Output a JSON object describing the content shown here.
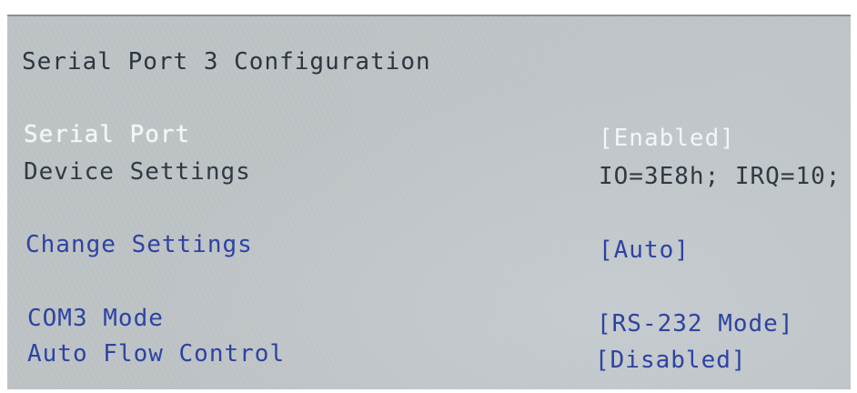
{
  "page": {
    "title": "Serial Port 3 Configuration"
  },
  "settings": [
    {
      "label": "Serial Port",
      "value": "[Enabled]"
    },
    {
      "label": "Device Settings",
      "value": "IO=3E8h; IRQ=10;"
    },
    {
      "label": "Change Settings",
      "value": "[Auto]"
    },
    {
      "label": "COM3 Mode",
      "value": "[RS-232 Mode]"
    },
    {
      "label": "Auto Flow Control",
      "value": "[Disabled]"
    }
  ],
  "colors": {
    "screen_background": "#bcc1c4",
    "selected_text": "#f3f6f8",
    "configurable_text": "#2d43a2",
    "static_text": "#303a44"
  }
}
